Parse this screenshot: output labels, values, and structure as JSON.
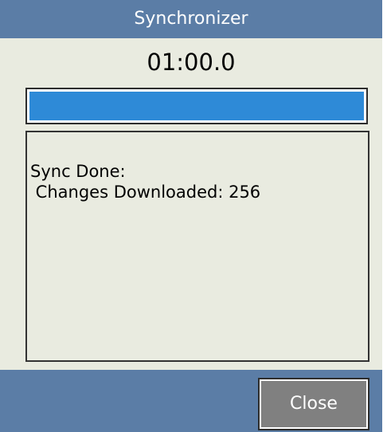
{
  "window": {
    "title": "Synchronizer"
  },
  "sync": {
    "timer": "01:00.0",
    "progress_fraction": 1.0,
    "log_lines": [
      "Sync Done:",
      " Changes Downloaded: 256"
    ]
  },
  "footer": {
    "close_label": "Close"
  },
  "colors": {
    "titlebar": "#5b7da6",
    "background": "#e9ebe0",
    "progress_fill": "#2e8ad7",
    "button": "#808080"
  }
}
